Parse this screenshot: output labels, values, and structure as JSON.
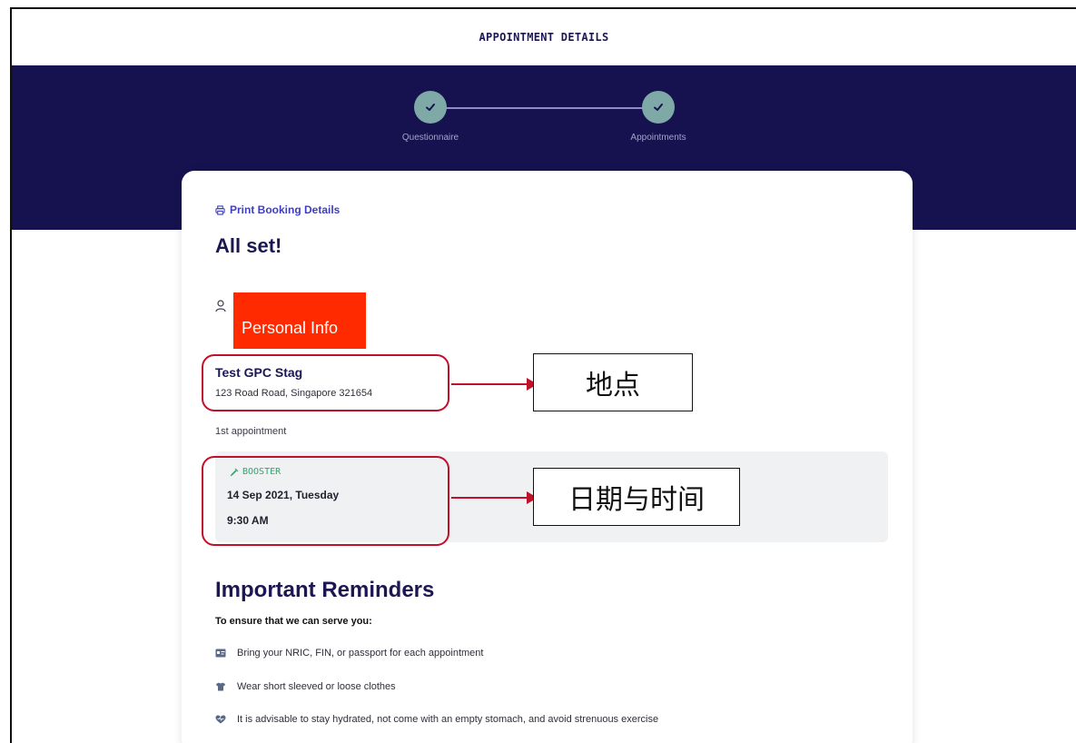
{
  "header": {
    "title": "APPOINTMENT DETAILS"
  },
  "stepper": {
    "steps": [
      {
        "label": "Questionnaire",
        "icon": "check-icon"
      },
      {
        "label": "Appointments",
        "icon": "check-icon"
      }
    ]
  },
  "card": {
    "print_label": "Print Booking Details",
    "heading": "All set!",
    "personal_info_redaction": "Personal Info",
    "location": {
      "name": "Test GPC Stag",
      "address": "123 Road Road, Singapore 321654"
    },
    "appointment_label": "1st appointment",
    "appointment": {
      "tag": "BOOSTER",
      "date": "14 Sep 2021, Tuesday",
      "time": "9:30 AM"
    },
    "reminders": {
      "title": "Important Reminders",
      "subtitle": "To ensure that we can serve you:",
      "items": [
        {
          "icon": "id-card-icon",
          "text": "Bring your NRIC, FIN, or passport for each appointment"
        },
        {
          "icon": "tshirt-icon",
          "text": "Wear short sleeved or loose clothes"
        },
        {
          "icon": "heart-icon",
          "text": "It is advisable to stay hydrated, not come with an empty stomach, and avoid strenuous exercise"
        }
      ]
    }
  },
  "annotations": {
    "location_label": "地点",
    "datetime_label": "日期与时间"
  },
  "colors": {
    "hero": "#15124f",
    "step_circle": "#7fa9a6",
    "link": "#3e3ec4",
    "booster": "#35a36a",
    "redaction": "#ff2a00",
    "annotation": "#c0102a"
  }
}
